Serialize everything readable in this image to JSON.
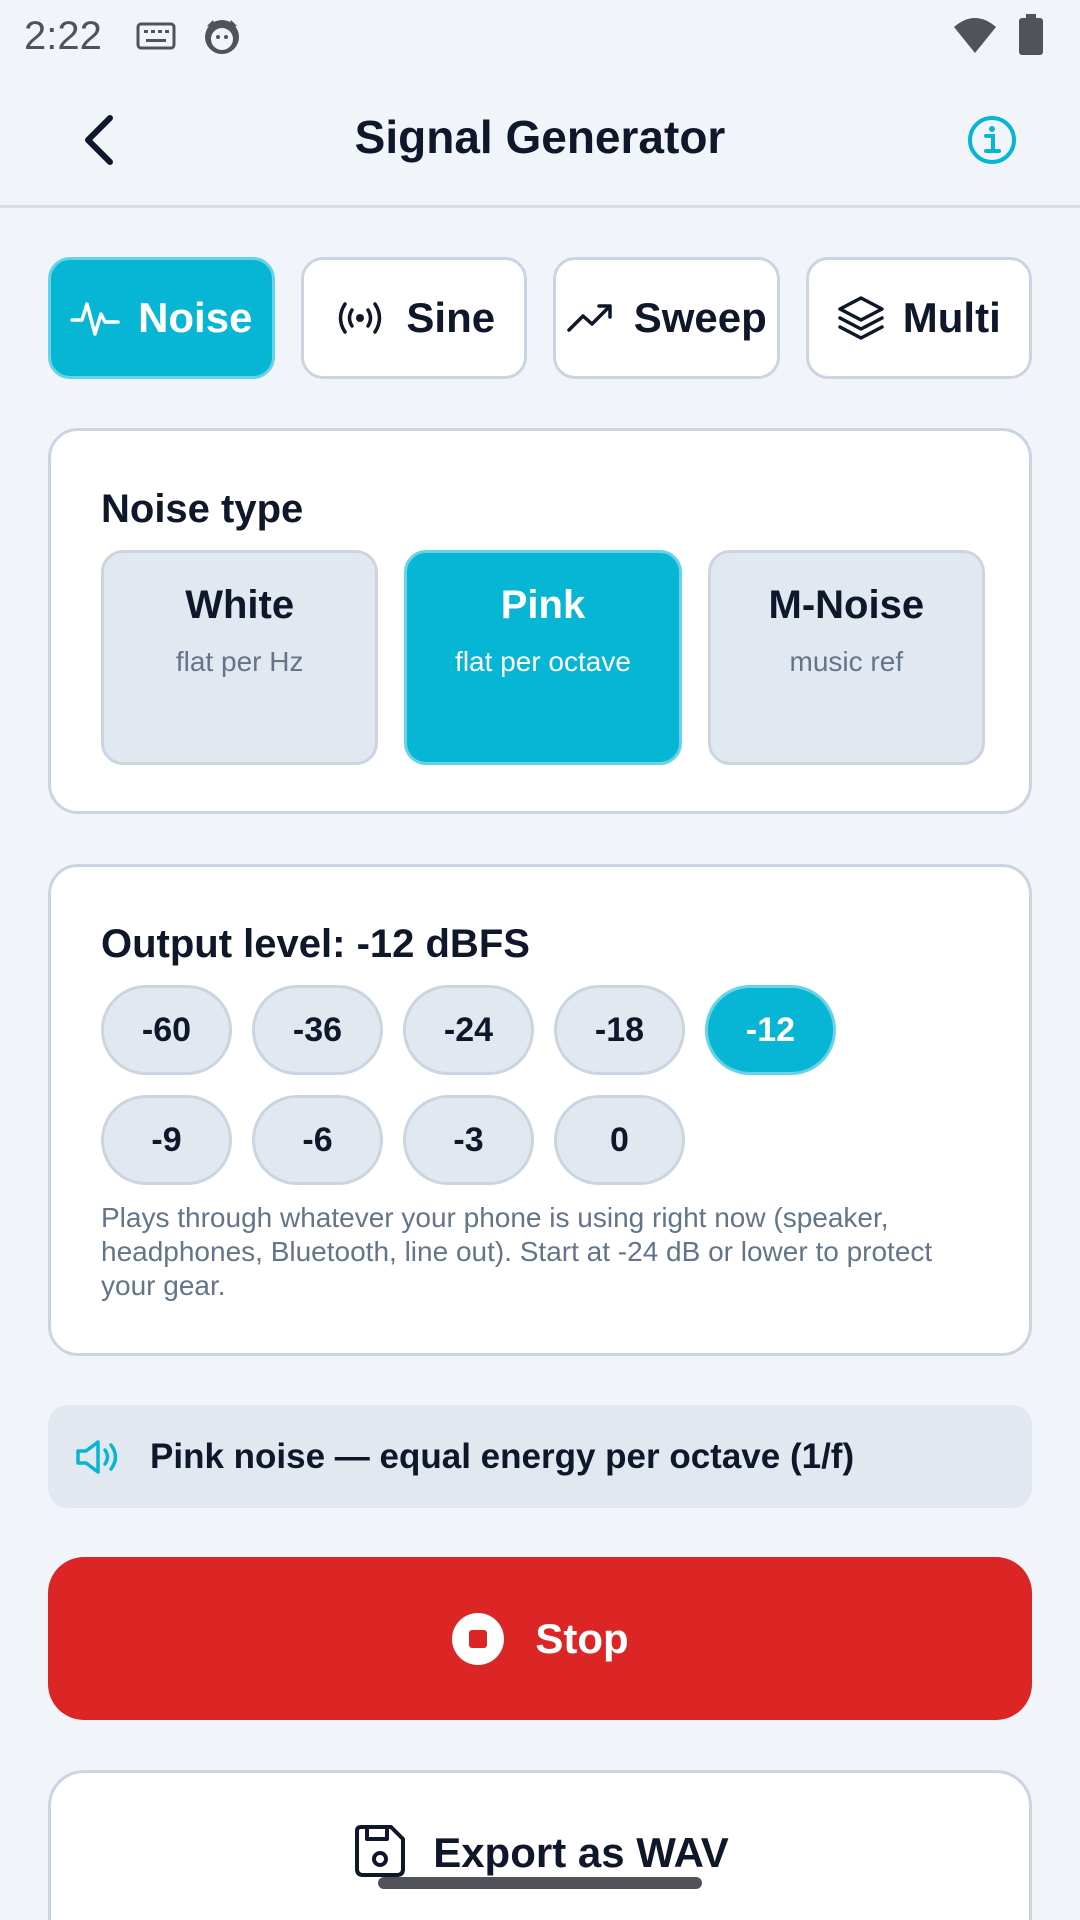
{
  "status_bar": {
    "time": "2:22",
    "icons": [
      "keyboard-icon",
      "cat-face-icon",
      "wifi-icon",
      "battery-icon"
    ]
  },
  "app_bar": {
    "title": "Signal Generator",
    "back_icon": "chevron-left-icon",
    "info_icon": "info-icon"
  },
  "tabs": [
    {
      "label": "Noise",
      "icon": "pulse-icon",
      "active": true
    },
    {
      "label": "Sine",
      "icon": "broadcast-icon",
      "active": false
    },
    {
      "label": "Sweep",
      "icon": "trend-up-icon",
      "active": false
    },
    {
      "label": "Multi",
      "icon": "layers-icon",
      "active": false
    }
  ],
  "noise_type": {
    "title": "Noise type",
    "options": [
      {
        "name": "White",
        "sub": "flat per Hz",
        "active": false
      },
      {
        "name": "Pink",
        "sub": "flat per octave",
        "active": true
      },
      {
        "name": "M-Noise",
        "sub": "music ref",
        "active": false
      }
    ]
  },
  "output": {
    "title": "Output level: -12 dBFS",
    "levels_row1": [
      "-60",
      "-36",
      "-24",
      "-18",
      "-12"
    ],
    "levels_row2": [
      "-9",
      "-6",
      "-3",
      "0"
    ],
    "selected": "-12",
    "hint": "Plays through whatever your phone is using right now (speaker, headphones, Bluetooth, line out). Start at -24 dB or lower to protect your gear."
  },
  "banner": {
    "text": "Pink noise — equal energy per octave (1/f)",
    "icon": "speaker-icon"
  },
  "stop_button": {
    "label": "Stop",
    "icon": "stop-circle-icon"
  },
  "export_button": {
    "label": "Export as WAV",
    "icon": "save-icon"
  },
  "colors": {
    "accent": "#06b6d4",
    "stop": "#dc2626",
    "background": "#f1f5f9"
  }
}
